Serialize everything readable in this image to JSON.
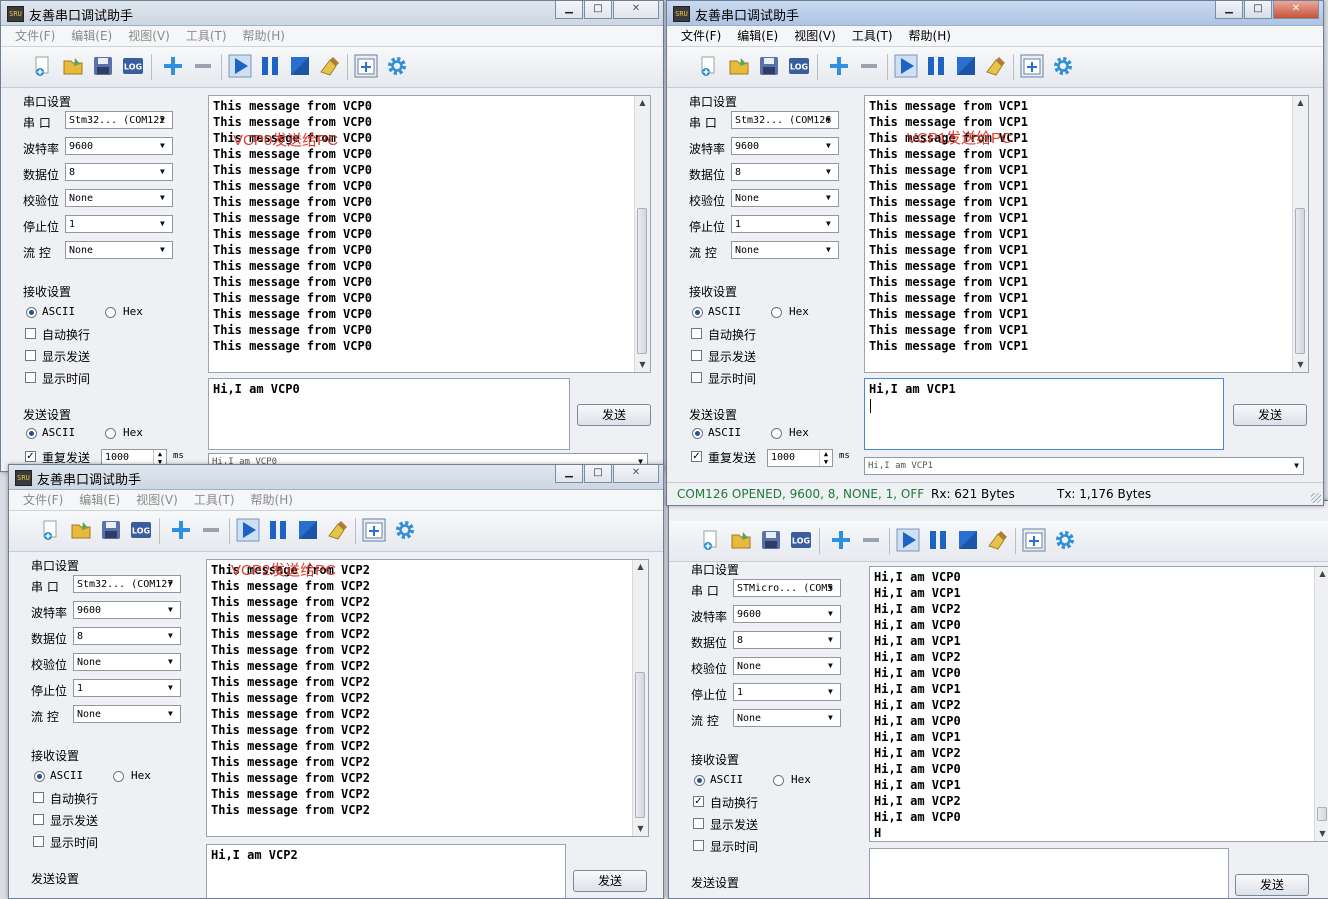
{
  "app": {
    "title": "友善串口调试助手",
    "icon_label": "SRU"
  },
  "menu": [
    "文件(F)",
    "编辑(E)",
    "视图(V)",
    "工具(T)",
    "帮助(H)"
  ],
  "serial_labels": {
    "group": "串口设置",
    "port": "串  口",
    "baud": "波特率",
    "data": "数据位",
    "parity": "校验位",
    "stop": "停止位",
    "flow": "流  控"
  },
  "recv_labels": {
    "group": "接收设置",
    "ascii": "ASCII",
    "hex": "Hex",
    "auto_wrap": "自动换行",
    "show_send": "显示发送",
    "show_time": "显示时间"
  },
  "send_labels": {
    "group": "发送设置",
    "ascii": "ASCII",
    "hex": "Hex",
    "repeat": "重复发送",
    "interval": "1000",
    "unit": "ms",
    "button": "发送"
  },
  "windows": {
    "w0": {
      "port": "Stm32... (COM122",
      "baud": "9600",
      "data": "8",
      "parity": "None",
      "stop": "1",
      "flow": "None",
      "recv_lines": [
        "This message from VCP0",
        "This message from VCP0",
        "This message from VCP0",
        "This message from VCP0",
        "This message from VCP0",
        "This message from VCP0",
        "This message from VCP0",
        "This message from VCP0",
        "This message from VCP0",
        "This message from VCP0",
        "This message from VCP0",
        "This message from VCP0",
        "This message from VCP0",
        "This message from VCP0",
        "This message from VCP0",
        "This message from VCP0"
      ],
      "annotation": "VCP0发送给PC",
      "send_text": "Hi,I am VCP0",
      "history": "Hi,I am VCP0"
    },
    "w1": {
      "port": "Stm32... (COM126",
      "baud": "9600",
      "data": "8",
      "parity": "None",
      "stop": "1",
      "flow": "None",
      "recv_lines": [
        "This message from VCP1",
        "This message from VCP1",
        "This message from VCP1",
        "This message from VCP1",
        "This message from VCP1",
        "This message from VCP1",
        "This message from VCP1",
        "This message from VCP1",
        "This message from VCP1",
        "This message from VCP1",
        "This message from VCP1",
        "This message from VCP1",
        "This message from VCP1",
        "This message from VCP1",
        "This message from VCP1",
        "This message from VCP1"
      ],
      "annotation": "VCP1发送给PC",
      "send_text": "Hi,I am VCP1",
      "history": "Hi,I am VCP1",
      "status": {
        "conn": "COM126 OPENED, 9600, 8, NONE, 1, OFF",
        "rx": "Rx: 621 Bytes",
        "tx": "Tx: 1,176 Bytes"
      }
    },
    "w2": {
      "port": "Stm32... (COM127",
      "baud": "9600",
      "data": "8",
      "parity": "None",
      "stop": "1",
      "flow": "None",
      "recv_lines": [
        "This message from VCP2",
        "This message from VCP2",
        "This message from VCP2",
        "This message from VCP2",
        "This message from VCP2",
        "This message from VCP2",
        "This message from VCP2",
        "This message from VCP2",
        "This message from VCP2",
        "This message from VCP2",
        "This message from VCP2",
        "This message from VCP2",
        "This message from VCP2",
        "This message from VCP2",
        "This message from VCP2",
        "This message from VCP2"
      ],
      "annotation": "VCP2发送给PC",
      "send_text": "Hi,I am VCP2"
    },
    "w3": {
      "port": "STMicro... (COM5",
      "baud": "9600",
      "data": "8",
      "parity": "None",
      "stop": "1",
      "flow": "None",
      "recv_lines": [
        "Hi,I am VCP0",
        "Hi,I am VCP1",
        "Hi,I am VCP2",
        "Hi,I am VCP0",
        "Hi,I am VCP1",
        "Hi,I am VCP2",
        "Hi,I am VCP0",
        "Hi,I am VCP1",
        "Hi,I am VCP2",
        "Hi,I am VCP0",
        "Hi,I am VCP1",
        "Hi,I am VCP2",
        "Hi,I am VCP0",
        "Hi,I am VCP1",
        "Hi,I am VCP2",
        "Hi,I am VCP0",
        "H"
      ]
    }
  },
  "colors": {
    "annotation": "#e03c30",
    "accent": "#2a5ea8"
  }
}
